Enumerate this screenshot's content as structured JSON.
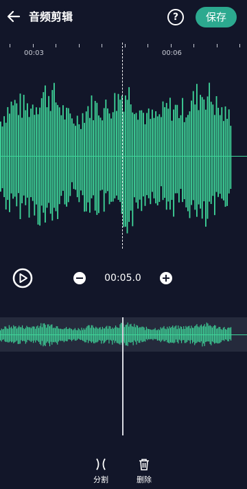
{
  "header": {
    "title": "音频剪辑",
    "help_label": "?",
    "save_label": "保存"
  },
  "ruler": {
    "labels": [
      "00:03",
      "00:06"
    ]
  },
  "controls": {
    "time": "00:05.0"
  },
  "toolbar": {
    "split_label": "分割",
    "delete_label": "删除"
  },
  "colors": {
    "background": "#121629",
    "accent": "#2ca98f",
    "waveform": "#3fd69a",
    "overview_bg": "#252a3c"
  },
  "icons": [
    "back-arrow-icon",
    "help-icon",
    "play-circle-icon",
    "minus-circle-icon",
    "plus-circle-icon",
    "split-icon",
    "trash-icon"
  ]
}
